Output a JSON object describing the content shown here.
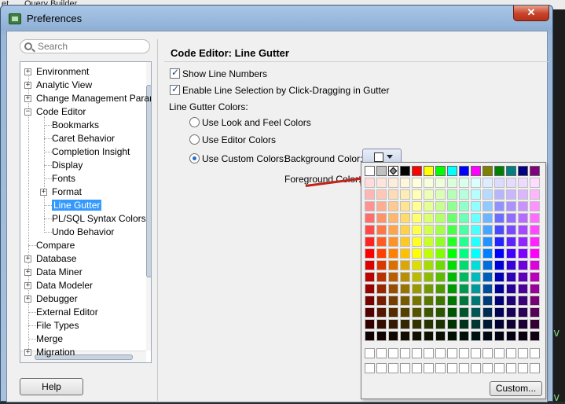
{
  "background": {
    "menu_left": "et",
    "menu_item": "Query Builder"
  },
  "window": {
    "title": "Preferences",
    "close_glyph": "✕"
  },
  "search": {
    "placeholder": "Search"
  },
  "tree": {
    "items": [
      {
        "label": "Environment",
        "level": 0,
        "expander": "+"
      },
      {
        "label": "Analytic View",
        "level": 0,
        "expander": "+"
      },
      {
        "label": "Change Management Parar",
        "level": 0,
        "expander": "+"
      },
      {
        "label": "Code Editor",
        "level": 0,
        "expander": "−"
      },
      {
        "label": "Bookmarks",
        "level": 1,
        "expander": ""
      },
      {
        "label": "Caret Behavior",
        "level": 1,
        "expander": ""
      },
      {
        "label": "Completion Insight",
        "level": 1,
        "expander": ""
      },
      {
        "label": "Display",
        "level": 1,
        "expander": ""
      },
      {
        "label": "Fonts",
        "level": 1,
        "expander": ""
      },
      {
        "label": "Format",
        "level": 1,
        "expander": "+"
      },
      {
        "label": "Line Gutter",
        "level": 1,
        "expander": "",
        "selected": true
      },
      {
        "label": "PL/SQL Syntax Colors",
        "level": 1,
        "expander": ""
      },
      {
        "label": "Undo Behavior",
        "level": 1,
        "expander": ""
      },
      {
        "label": "Compare",
        "level": 0,
        "expander": ""
      },
      {
        "label": "Database",
        "level": 0,
        "expander": "+"
      },
      {
        "label": "Data Miner",
        "level": 0,
        "expander": "+"
      },
      {
        "label": "Data Modeler",
        "level": 0,
        "expander": "+"
      },
      {
        "label": "Debugger",
        "level": 0,
        "expander": "+"
      },
      {
        "label": "External Editor",
        "level": 0,
        "expander": ""
      },
      {
        "label": "File Types",
        "level": 0,
        "expander": ""
      },
      {
        "label": "Merge",
        "level": 0,
        "expander": ""
      },
      {
        "label": "Migration",
        "level": 0,
        "expander": "+"
      }
    ]
  },
  "help_button": "Help",
  "panel": {
    "title": "Code Editor: Line Gutter",
    "show_line_numbers": "Show Line Numbers",
    "enable_line_selection": "Enable Line Selection by Click-Dragging in Gutter",
    "gutter_colors_label": "Line Gutter Colors:",
    "use_look_and_feel": "Use Look and Feel Colors",
    "use_editor_colors": "Use Editor Colors",
    "use_custom_colors": "Use Custom Colors:",
    "background_color_label": "Background Color:",
    "foreground_color_label": "Foreground Color:",
    "selected_radio": "use_custom_colors"
  },
  "color_popup": {
    "custom_button": "Custom...",
    "top_row": [
      "#ffffff",
      "#c0c0c0",
      "#808080",
      "#000000",
      "#ff0000",
      "#ffff00",
      "#00ff00",
      "#00ffff",
      "#0000ff",
      "#ff00ff",
      "#808000",
      "#008000",
      "#008080",
      "#000080",
      "#800080"
    ],
    "columns": [
      "#ff0000",
      "#ff4000",
      "#ff8000",
      "#ffc000",
      "#ffff00",
      "#c0ff00",
      "#80ff00",
      "#00ff00",
      "#00ff80",
      "#00ffff",
      "#0080ff",
      "#0000ff",
      "#4000ff",
      "#8000ff",
      "#ff00ff"
    ]
  },
  "background_right": {
    "glyph1": "v",
    "glyph2": "v"
  }
}
